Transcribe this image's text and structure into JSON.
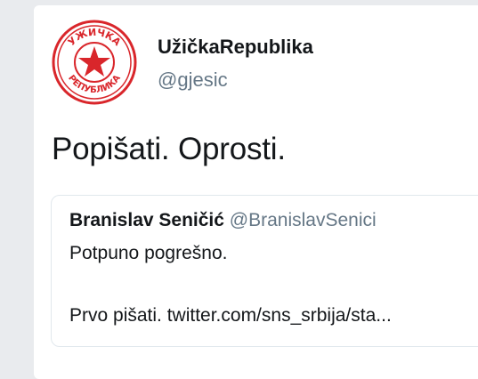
{
  "user": {
    "display_name": "UžičkaRepublika",
    "handle": "@gjesic",
    "avatar_icon": "red-star-seal-logo",
    "avatar_text_top": "УЖИЧКА",
    "avatar_text_bottom": "РЕПУБЛИКА"
  },
  "tweet": {
    "text": "Popišati. Oprosti."
  },
  "quoted_tweet": {
    "author_name": "Branislav Seničić",
    "author_handle": "@BranislavSenici",
    "line1": "Potpuno pogrešno.",
    "line2": "Prvo pišati. twitter.com/sns_srbija/sta..."
  },
  "colors": {
    "accent_red": "#d9262b",
    "text_primary": "#14171a",
    "text_secondary": "#657786",
    "background": "#e9ebee"
  }
}
